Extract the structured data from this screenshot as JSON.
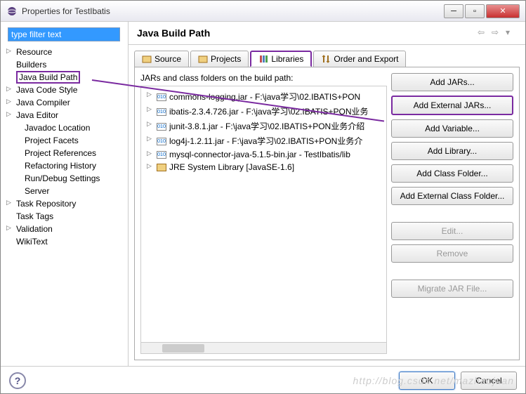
{
  "window": {
    "title": "Properties for TestIbatis"
  },
  "filter": {
    "placeholder": "type filter text"
  },
  "tree": [
    {
      "label": "Resource",
      "parent": true
    },
    {
      "label": "Builders"
    },
    {
      "label": "Java Build Path",
      "selected": true
    },
    {
      "label": "Java Code Style",
      "parent": true
    },
    {
      "label": "Java Compiler",
      "parent": true
    },
    {
      "label": "Java Editor",
      "parent": true
    },
    {
      "label": "Javadoc Location",
      "child": true
    },
    {
      "label": "Project Facets",
      "child": true
    },
    {
      "label": "Project References",
      "child": true
    },
    {
      "label": "Refactoring History",
      "child": true
    },
    {
      "label": "Run/Debug Settings",
      "child": true
    },
    {
      "label": "Server",
      "child": true
    },
    {
      "label": "Task Repository",
      "parent": true
    },
    {
      "label": "Task Tags"
    },
    {
      "label": "Validation",
      "parent": true
    },
    {
      "label": "WikiText"
    }
  ],
  "header": {
    "title": "Java Build Path"
  },
  "tabs": {
    "source": "Source",
    "projects": "Projects",
    "libraries": "Libraries",
    "order": "Order and Export"
  },
  "jarLabel": "JARs and class folders on the build path:",
  "jars": [
    {
      "text": "commons-logging.jar - F:\\java学习\\02.IBATIS+PON"
    },
    {
      "text": "ibatis-2.3.4.726.jar - F:\\java学习\\02.IBATIS+PON业务"
    },
    {
      "text": "junit-3.8.1.jar - F:\\java学习\\02.IBATIS+PON业务介绍"
    },
    {
      "text": "log4j-1.2.11.jar - F:\\java学习\\02.IBATIS+PON业务介"
    },
    {
      "text": "mysql-connector-java-5.1.5-bin.jar - TestIbatis/lib"
    },
    {
      "text": "JRE System Library [JavaSE-1.6]",
      "lib": true
    }
  ],
  "buttons": {
    "addJars": "Add JARs...",
    "addExternalJars": "Add External JARs...",
    "addVariable": "Add Variable...",
    "addLibrary": "Add Library...",
    "addClassFolder": "Add Class Folder...",
    "addExternalClassFolder": "Add External Class Folder...",
    "edit": "Edit...",
    "remove": "Remove",
    "migrate": "Migrate JAR File..."
  },
  "footer": {
    "ok": "OK",
    "cancel": "Cancel"
  },
  "watermark": "http://blog.csdn.net/mazhaojuan"
}
